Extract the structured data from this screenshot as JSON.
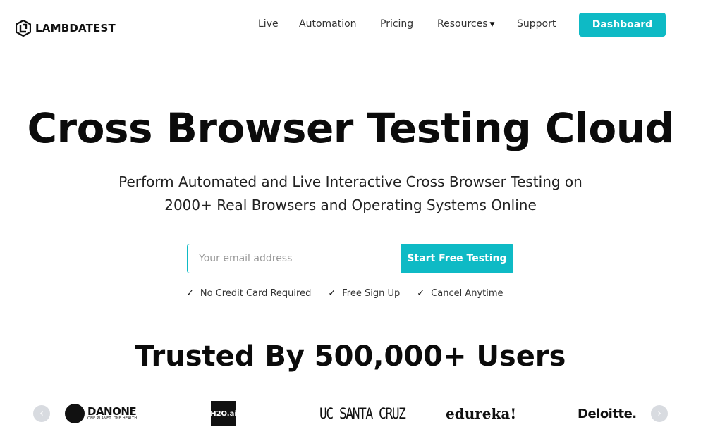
{
  "brand": {
    "logo_text": "LAMBDATEST"
  },
  "nav": {
    "items": [
      {
        "label": "Live"
      },
      {
        "label": "Automation"
      },
      {
        "label": "Pricing"
      },
      {
        "label": "Resources"
      },
      {
        "label": "Support"
      }
    ],
    "dashboard_label": "Dashboard"
  },
  "hero": {
    "title": "Cross Browser Testing Cloud",
    "subtitle_line1": "Perform Automated and Live Interactive Cross Browser Testing on",
    "subtitle_line2": "2000+ Real Browsers and Operating Systems Online"
  },
  "signup": {
    "email_placeholder": "Your email address",
    "cta_label": "Start Free Testing",
    "features": [
      "No Credit Card Required",
      "Free Sign Up",
      "Cancel Anytime"
    ]
  },
  "trusted": {
    "heading": "Trusted By 500,000+ Users"
  },
  "logos": {
    "danone": "DANONE",
    "danone_tagline": "ONE PLANET. ONE HEALTH",
    "h2o": "H2O.ai",
    "ucsc": "UC SANTA CRUZ",
    "edureka": "edureka!",
    "deloitte": "Deloitte."
  },
  "colors": {
    "accent": "#0ebac5"
  }
}
